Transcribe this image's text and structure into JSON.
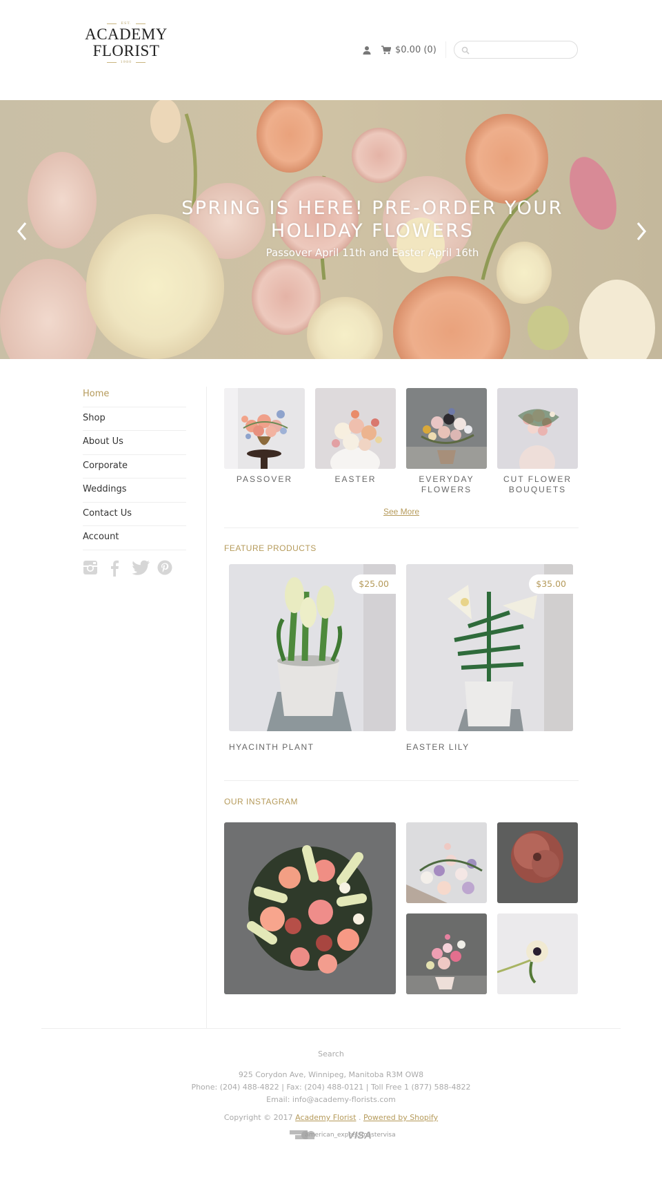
{
  "header": {
    "logo": {
      "est": "EST.",
      "line1": "ACADEMY",
      "line2": "FLORIST",
      "year": "1980"
    },
    "account_icon": "user-icon",
    "cart": {
      "icon": "cart-icon",
      "total": "$0.00 (0)"
    },
    "search": {
      "icon": "search-icon",
      "value": "",
      "placeholder": ""
    }
  },
  "hero": {
    "title": "SPRING IS HERE! PRE-ORDER YOUR HOLIDAY FLOWERS",
    "subtitle": "Passover April 11th and Easter April 16th",
    "prev_icon": "chevron-left-icon",
    "next_icon": "chevron-right-icon"
  },
  "sidebar": {
    "items": [
      {
        "label": "Home",
        "active": true
      },
      {
        "label": "Shop",
        "active": false
      },
      {
        "label": "About Us",
        "active": false
      },
      {
        "label": "Corporate",
        "active": false
      },
      {
        "label": "Weddings",
        "active": false
      },
      {
        "label": "Contact Us",
        "active": false
      },
      {
        "label": "Account",
        "active": false
      }
    ],
    "socials": [
      "instagram-icon",
      "facebook-icon",
      "twitter-icon",
      "pinterest-icon"
    ]
  },
  "collections": {
    "items": [
      {
        "label": "PASSOVER"
      },
      {
        "label": "EASTER"
      },
      {
        "label": "EVERYDAY FLOWERS"
      },
      {
        "label": "CUT FLOWER BOUQUETS"
      }
    ],
    "see_more": "See More"
  },
  "featured": {
    "title": "FEATURE PRODUCTS",
    "products": [
      {
        "name": "HYACINTH PLANT",
        "price": "$25.00"
      },
      {
        "name": "EASTER LILY",
        "price": "$35.00"
      }
    ]
  },
  "instagram": {
    "title": "OUR INSTAGRAM"
  },
  "footer": {
    "search_link": "Search",
    "address": "925 Corydon Ave, Winnipeg, Manitoba R3M OW8",
    "phone": "Phone: (204) 488-4822 | Fax: (204) 488-0121 | Toll Free 1 (877) 588-4822",
    "email": "Email: info@academy-florists.com",
    "copyright_prefix": "Copyright © 2017",
    "brand_link": "Academy Florist",
    "separator": ".",
    "powered_link": "Powered by Shopify",
    "payment_text": "american_expressmastervisa",
    "payments": [
      "american-express-icon",
      "master-icon",
      "visa-icon"
    ]
  },
  "colors": {
    "accent": "#b59a5a",
    "text": "#333333",
    "muted": "#aaaaaa",
    "border": "#eeeeee"
  }
}
